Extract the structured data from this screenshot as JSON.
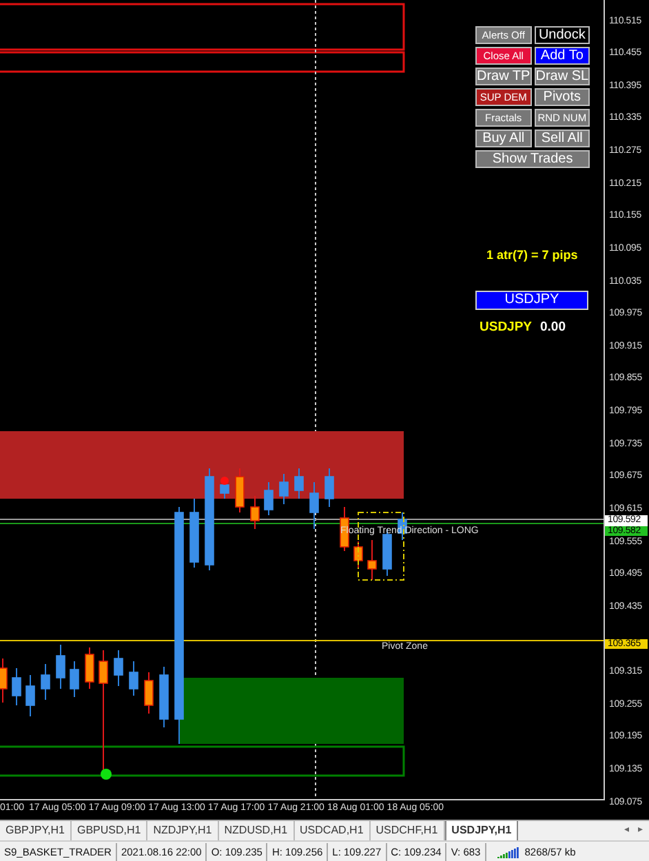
{
  "chart": {
    "panel_buttons": [
      {
        "label": "Alerts Off",
        "kind": "compact",
        "color": "#777777"
      },
      {
        "label": "Undock",
        "kind": "normal",
        "color": "#000000"
      },
      {
        "label": "Close All",
        "kind": "compact",
        "color": "#e5103c"
      },
      {
        "label": "Add To",
        "kind": "normal",
        "color": "#0000ff"
      },
      {
        "label": "Draw TP",
        "kind": "normal",
        "color": "#777777"
      },
      {
        "label": "Draw SL",
        "kind": "normal",
        "color": "#777777"
      },
      {
        "label": "SUP DEM",
        "kind": "compact",
        "color": "#b01c1c"
      },
      {
        "label": "Pivots",
        "kind": "normal",
        "color": "#777777"
      },
      {
        "label": "Fractals",
        "kind": "compact",
        "color": "#777777"
      },
      {
        "label": "RND NUM",
        "kind": "compact",
        "color": "#777777"
      },
      {
        "label": "Buy All",
        "kind": "normal",
        "color": "#777777"
      },
      {
        "label": "Sell All",
        "kind": "normal",
        "color": "#777777"
      },
      {
        "label": "Show Trades",
        "kind": "wide",
        "color": "#777777"
      }
    ],
    "atr_label": "1 atr(7) = 7 pips",
    "symbol_box": "USDJPY",
    "symbol_label": "USDJPY",
    "symbol_value": "0.00",
    "trend_label": "Floating Trend Direction - LONG",
    "pivot_label": "Pivot Zone"
  },
  "price_axis": {
    "ticks": [
      "110.515",
      "110.455",
      "110.395",
      "110.335",
      "110.275",
      "110.215",
      "110.155",
      "110.095",
      "110.035",
      "109.975",
      "109.915",
      "109.855",
      "109.795",
      "109.735",
      "109.675",
      "109.615",
      "109.555",
      "109.495",
      "109.435",
      "109.315",
      "109.255",
      "109.195",
      "109.135",
      "109.075"
    ],
    "tags": [
      {
        "label": "109.592",
        "color": "#ffffff"
      },
      {
        "label": "109.582",
        "color": "#22c022"
      },
      {
        "label": "109.365",
        "color": "#f0d000"
      }
    ]
  },
  "time_axis": {
    "labels": [
      "01:00",
      "17 Aug 05:00",
      "17 Aug 09:00",
      "17 Aug 13:00",
      "17 Aug 17:00",
      "17 Aug 21:00",
      "18 Aug 01:00",
      "18 Aug 05:00"
    ]
  },
  "tabs": [
    {
      "label": "GBPJPY,H1",
      "selected": false
    },
    {
      "label": "GBPUSD,H1",
      "selected": false
    },
    {
      "label": "NZDJPY,H1",
      "selected": false
    },
    {
      "label": "NZDUSD,H1",
      "selected": false
    },
    {
      "label": "USDCAD,H1",
      "selected": false
    },
    {
      "label": "USDCHF,H1",
      "selected": false
    },
    {
      "label": "USDJPY,H1",
      "selected": true
    }
  ],
  "tab_arrows": [
    "◂",
    "▸"
  ],
  "status_bar": {
    "fields": [
      "S9_BASKET_TRADER",
      "2021.08.16 22:00",
      "O: 109.235",
      "H: 109.256",
      "L: 109.227",
      "C: 109.234",
      "V: 683"
    ],
    "memory": "8268/57 kb"
  }
}
